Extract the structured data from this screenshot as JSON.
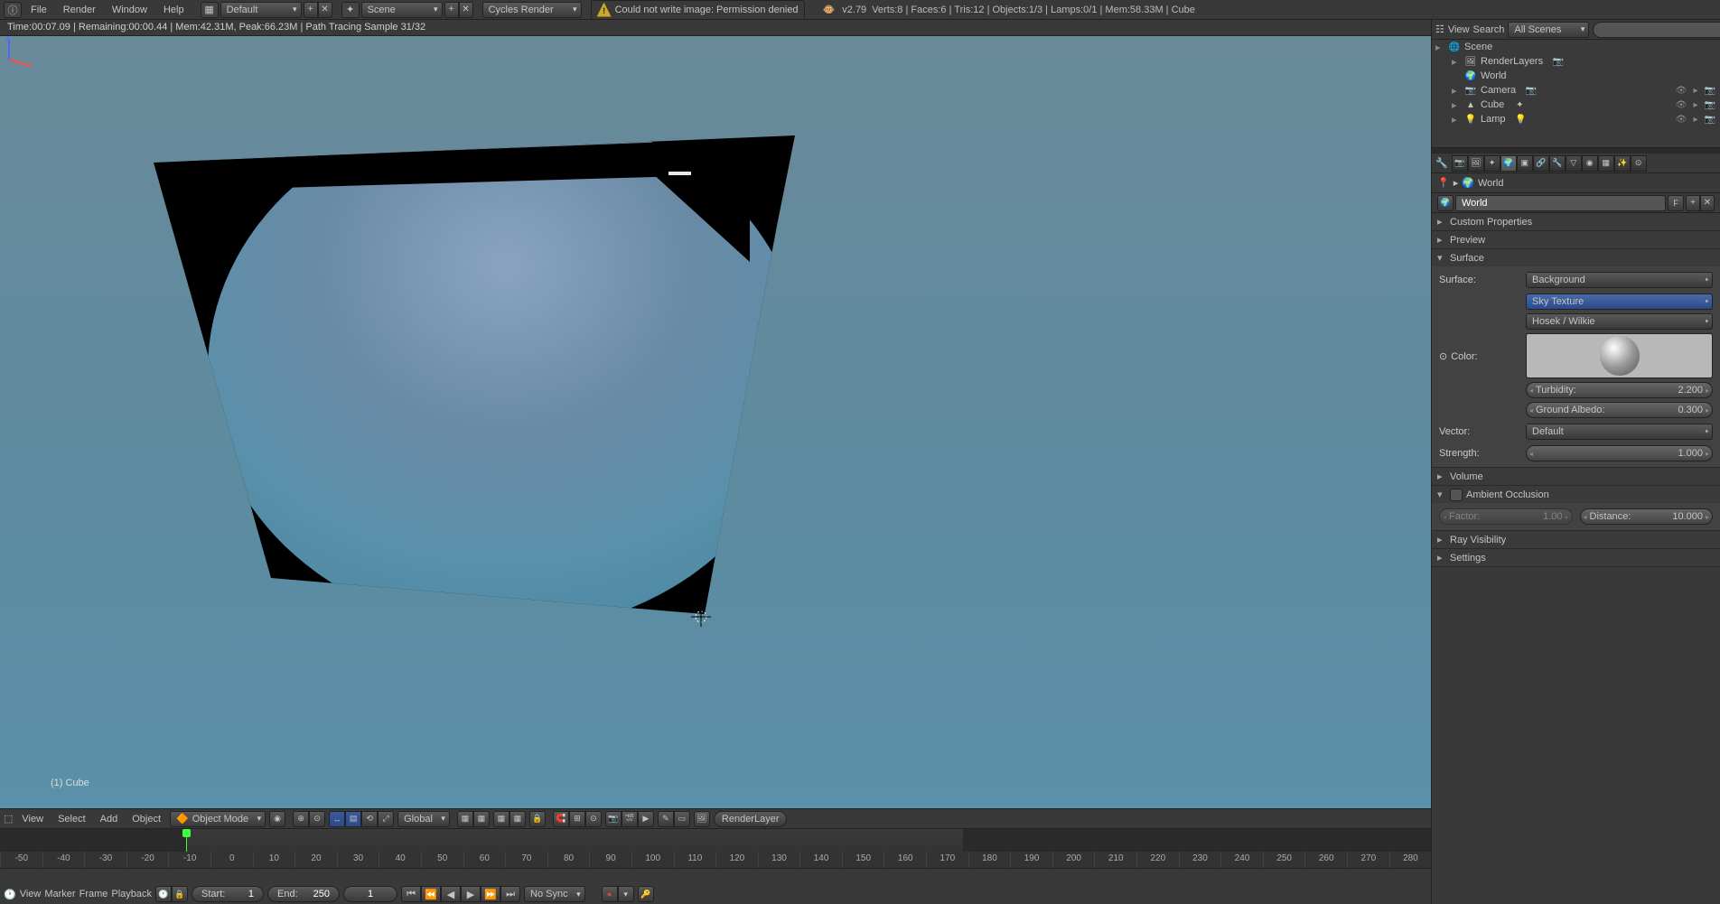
{
  "topbar": {
    "menus": [
      "File",
      "Render",
      "Window",
      "Help"
    ],
    "layout": "Default",
    "scene": "Scene",
    "engine": "Cycles Render",
    "warning": "Could not write image: Permission denied",
    "version": "v2.79",
    "stats": "Verts:8 | Faces:6 | Tris:12 | Objects:1/3 | Lamps:0/1 | Mem:58.33M | Cube"
  },
  "render_info": "Time:00:07.09 | Remaining:00:00.44 | Mem:42.31M, Peak:66.23M | Path Tracing Sample 31/32",
  "viewport": {
    "object_label": "(1) Cube"
  },
  "view_header": {
    "menus": [
      "View",
      "Select",
      "Add",
      "Object"
    ],
    "mode": "Object Mode",
    "orientation": "Global",
    "render_slot": "RenderLayer"
  },
  "timeline": {
    "ticks": [
      "-50",
      "-40",
      "-30",
      "-20",
      "-10",
      "0",
      "10",
      "20",
      "30",
      "40",
      "50",
      "60",
      "70",
      "80",
      "90",
      "100",
      "110",
      "120",
      "130",
      "140",
      "150",
      "160",
      "170",
      "180",
      "190",
      "200",
      "210",
      "220",
      "230",
      "240",
      "250",
      "260",
      "270",
      "280"
    ],
    "menus": [
      "View",
      "Marker",
      "Frame",
      "Playback"
    ],
    "start_label": "Start:",
    "start_val": "1",
    "end_label": "End:",
    "end_val": "250",
    "cur_val": "1",
    "sync": "No Sync"
  },
  "outliner": {
    "header": {
      "view": "View",
      "search": "Search",
      "filter": "All Scenes"
    },
    "items": [
      {
        "name": "Scene",
        "icon": "🌐",
        "depth": 0,
        "expandable": true
      },
      {
        "name": "RenderLayers",
        "icon": "🖼",
        "depth": 1,
        "expandable": true,
        "extra": "📷"
      },
      {
        "name": "World",
        "icon": "🌍",
        "depth": 1,
        "expandable": false
      },
      {
        "name": "Camera",
        "icon": "📷",
        "depth": 1,
        "expandable": true,
        "extra": "📷",
        "restrict": true
      },
      {
        "name": "Cube",
        "icon": "▲",
        "depth": 1,
        "expandable": true,
        "extra": "✦",
        "restrict": true
      },
      {
        "name": "Lamp",
        "icon": "💡",
        "depth": 1,
        "expandable": true,
        "extra": "💡",
        "restrict": true
      }
    ]
  },
  "props": {
    "breadcrumb": "World",
    "datablock": "World",
    "fake_user": "F",
    "panels": {
      "custom": "Custom Properties",
      "preview": "Preview",
      "surface": {
        "title": "Surface",
        "surface_lbl": "Surface:",
        "surface_val": "Background",
        "color_lbl": "Color:",
        "color_val": "Sky Texture",
        "sky_model": "Hosek / Wilkie",
        "turbidity_lbl": "Turbidity:",
        "turbidity_val": "2.200",
        "albedo_lbl": "Ground Albedo:",
        "albedo_val": "0.300",
        "vector_lbl": "Vector:",
        "vector_val": "Default",
        "strength_lbl": "Strength:",
        "strength_val": "1.000"
      },
      "volume": "Volume",
      "ao": {
        "title": "Ambient Occlusion",
        "factor_lbl": "Factor:",
        "factor_val": "1.00",
        "distance_lbl": "Distance:",
        "distance_val": "10.000"
      },
      "ray": "Ray Visibility",
      "settings": "Settings"
    }
  }
}
